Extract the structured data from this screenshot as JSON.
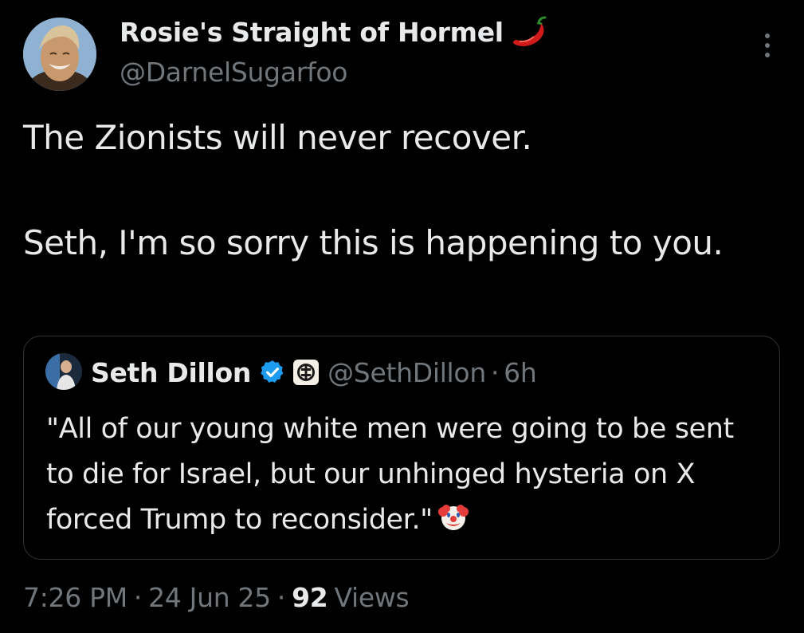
{
  "author": {
    "display_name": "Rosie's Straight of Hormel",
    "handle": "@DarnelSugarfoo",
    "name_emoji": "hot-pepper-icon"
  },
  "tweet": {
    "lines": [
      "The Zionists will never recover.",
      "Seth, I'm so sorry this is happening to you."
    ]
  },
  "quote": {
    "name": "Seth Dillon",
    "handle": "@SethDillon",
    "separator": "·",
    "time": "6h",
    "text": "\"All of our young white men were going to be sent to die for Israel, but our unhinged hysteria on X forced Trump to reconsider.\"",
    "emoji": "clown-face-icon",
    "verified_color": "#1d9bf0"
  },
  "meta": {
    "time": "7:26 PM",
    "date": "24 Jun 25",
    "separator": "·",
    "views_count": "92",
    "views_label": "Views"
  },
  "colors": {
    "background": "#000000",
    "primary_text": "#e7e9ea",
    "secondary_text": "#71767b",
    "border": "#2f3336"
  }
}
